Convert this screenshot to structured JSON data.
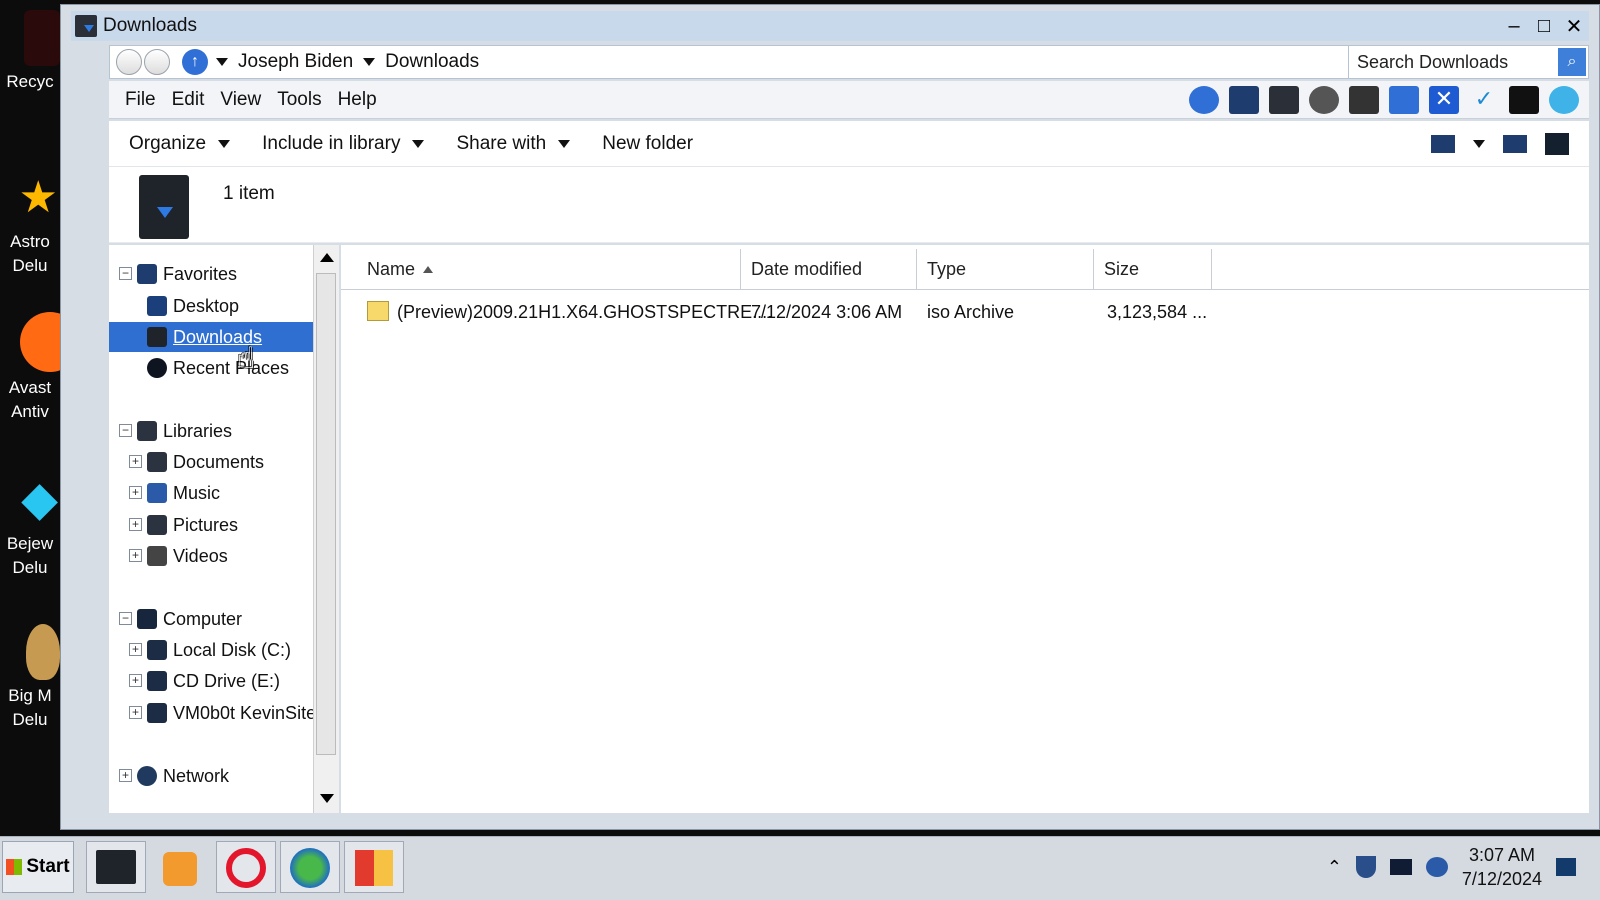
{
  "desktop": {
    "icons": [
      {
        "label": "Recyc",
        "label2": ""
      },
      {
        "label": "Astro",
        "label2": "Delu"
      },
      {
        "label": "Avast",
        "label2": "Antiv"
      },
      {
        "label": "Bejew",
        "label2": "Delu"
      },
      {
        "label": "Big M",
        "label2": "Delu"
      }
    ]
  },
  "window": {
    "title": "Downloads",
    "minimize": "–",
    "maximize": "□",
    "close": "✕"
  },
  "address": {
    "crumbs": [
      "Joseph Biden",
      "Downloads"
    ],
    "search_placeholder": "Search Downloads"
  },
  "menu": [
    "File",
    "Edit",
    "View",
    "Tools",
    "Help"
  ],
  "commands": {
    "organize": "Organize",
    "include_library": "Include in library",
    "share_with": "Share with",
    "new_folder": "New folder"
  },
  "details": {
    "count": "1 item"
  },
  "nav": {
    "favorites": "Favorites",
    "desktop": "Desktop",
    "downloads": "Downloads",
    "recent": "Recent Places",
    "libraries": "Libraries",
    "documents": "Documents",
    "music": "Music",
    "pictures": "Pictures",
    "videos": "Videos",
    "computer": "Computer",
    "local_disk": "Local Disk (C:)",
    "cd_drive": "CD Drive (E:)",
    "share": "VM0b0t KevinSite",
    "network": "Network"
  },
  "columns": {
    "name": "Name",
    "date": "Date modified",
    "type": "Type",
    "size": "Size"
  },
  "files": [
    {
      "name": "(Preview)2009.21H1.X64.GHOSTSPECTRE....",
      "date": "7/12/2024 3:06 AM",
      "type": "iso Archive",
      "size": "3,123,584 ..."
    }
  ],
  "taskbar": {
    "start": "Start",
    "time": "3:07 AM",
    "date": "7/12/2024"
  }
}
